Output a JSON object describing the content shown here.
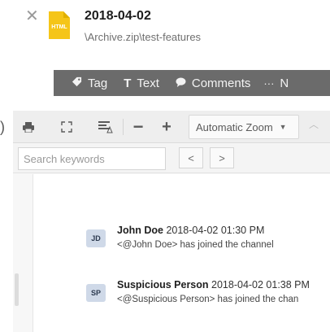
{
  "header": {
    "title": "2018-04-02",
    "path": "\\Archive.zip\\test-features",
    "file_type_label": "HTML"
  },
  "actions": [
    {
      "label": "Tag",
      "icon": "tag-icon",
      "glyph": "🏷"
    },
    {
      "label": "Text",
      "icon": "text-icon",
      "glyph": "T"
    },
    {
      "label": "Comments",
      "icon": "comment-icon",
      "glyph": "💬"
    },
    {
      "label": "N",
      "icon": "more-icon",
      "glyph": "···"
    }
  ],
  "toolbar": {
    "zoom_value": "Automatic Zoom"
  },
  "find": {
    "placeholder": "Search keywords"
  },
  "messages": [
    {
      "initials": "JD",
      "name": "John Doe",
      "timestamp": "2018-04-02 01:30 PM",
      "text": "<@John Doe> has joined the channel"
    },
    {
      "initials": "SP",
      "name": "Suspicious Person",
      "timestamp": "2018-04-02 01:38 PM",
      "text": "<@Suspicious Person> has joined the chan"
    }
  ],
  "colors": {
    "action_bar": "#6b6b6b",
    "file_icon": "#f5c518",
    "avatar_bg": "#cfd9e8"
  }
}
